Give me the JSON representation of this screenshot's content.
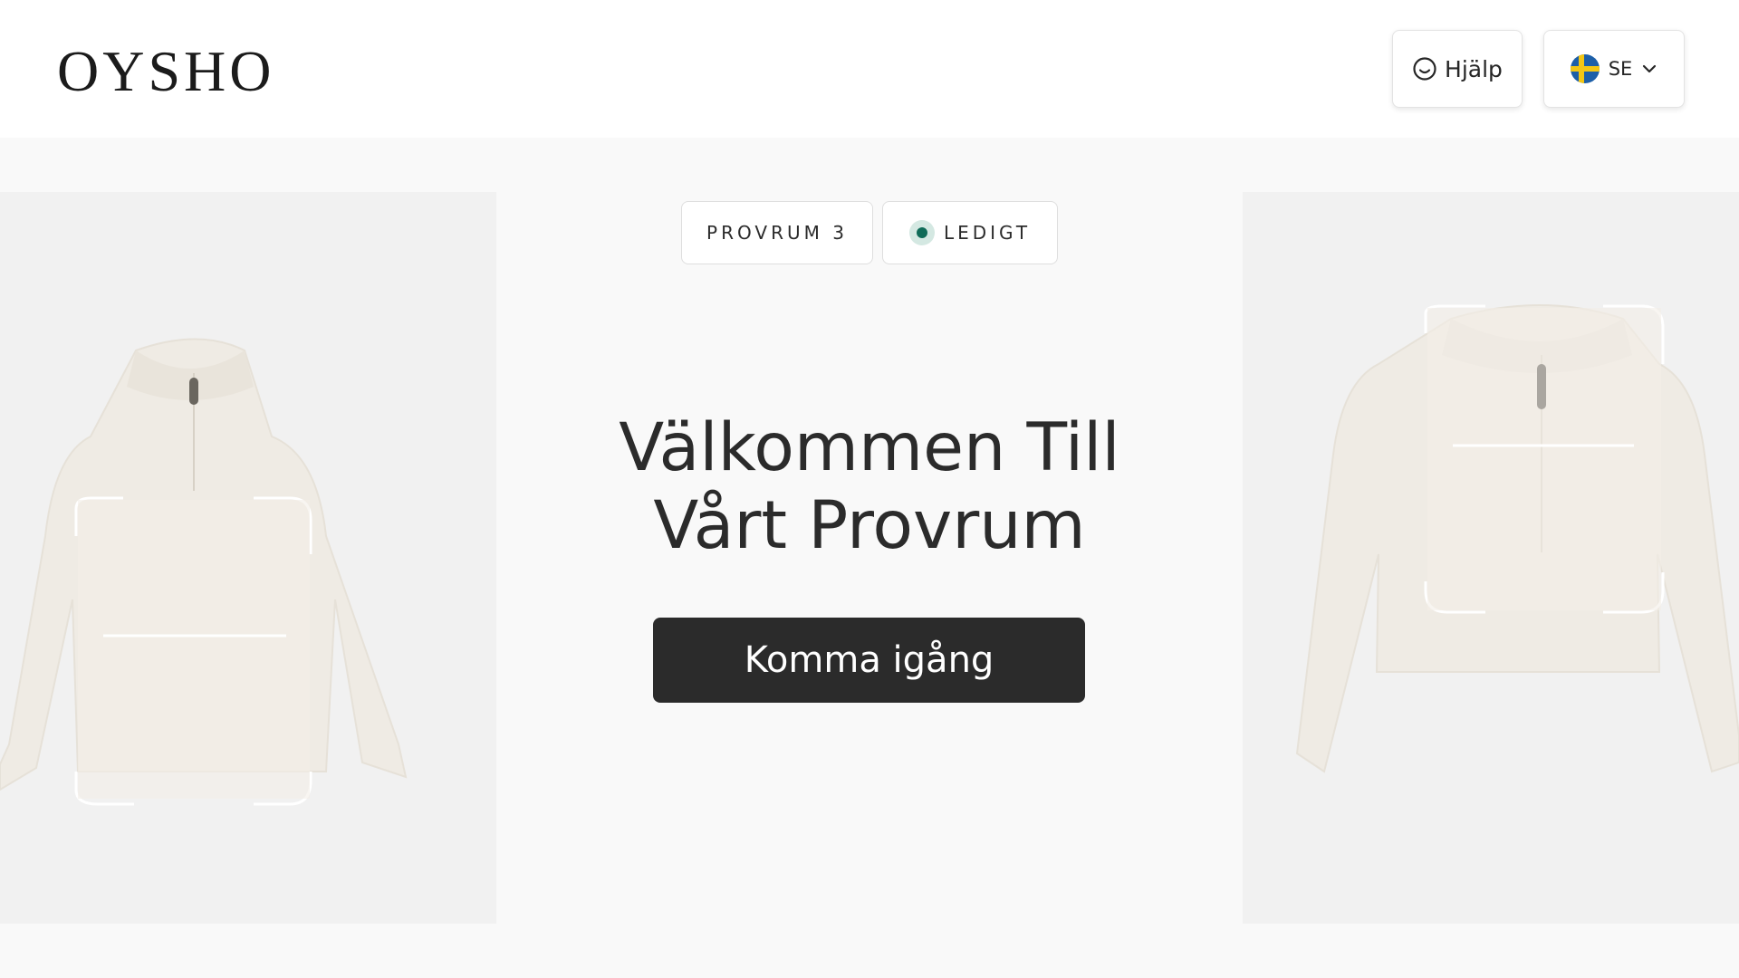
{
  "header": {
    "logo_text": "OYSHO",
    "help_label": "Hjälp",
    "help_icon": "smiley-icon",
    "language_code": "SE",
    "language_flag_icon": "sweden-flag-icon",
    "language_chevron_icon": "chevron-down-icon"
  },
  "status": {
    "room_label": "PROVRUM 3",
    "availability_label": "LEDIGT",
    "availability_color": "#0f6b58"
  },
  "main": {
    "title_line1": "Välkommen Till",
    "title_line2": "Vårt Provrum",
    "cta_label": "Komma igång"
  },
  "images": {
    "left": "cream-half-zip-sweater-image",
    "right": "cream-cropped-half-zip-sweater-image"
  },
  "colors": {
    "background": "#f9f9f9",
    "header_bg": "#ffffff",
    "panel_bg": "#f1f1f1",
    "cta_bg": "#2b2b2b",
    "cta_text": "#ffffff"
  }
}
